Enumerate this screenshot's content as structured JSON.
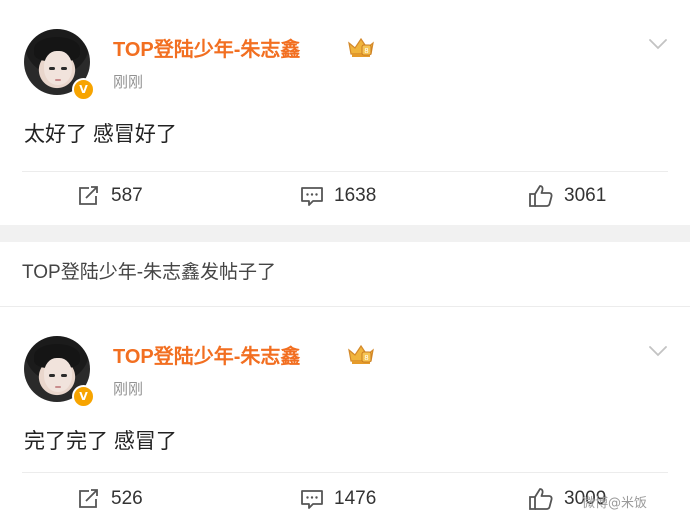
{
  "posts": [
    {
      "username": "TOP登陆少年-朱志鑫",
      "verified_badge": "V",
      "timestamp": "刚刚",
      "content": "太好了 感冒好了",
      "repost_count": "587",
      "comment_count": "1638",
      "like_count": "3061"
    },
    {
      "username": "TOP登陆少年-朱志鑫",
      "verified_badge": "V",
      "timestamp": "刚刚",
      "content": "完了完了 感冒了",
      "repost_count": "526",
      "comment_count": "1476",
      "like_count": "3009"
    }
  ],
  "banner": {
    "text": "TOP登陆少年-朱志鑫发帖子了"
  },
  "watermark": "微博@米饭",
  "colors": {
    "username": "#f26f21",
    "badge": "#f7a400",
    "timestamp": "#939393",
    "divider_band": "#f1f1f1"
  },
  "icons": [
    "avatar",
    "verified-v-icon",
    "crown-badge-icon",
    "chevron-down-icon",
    "repost-icon",
    "comment-icon",
    "like-icon"
  ]
}
